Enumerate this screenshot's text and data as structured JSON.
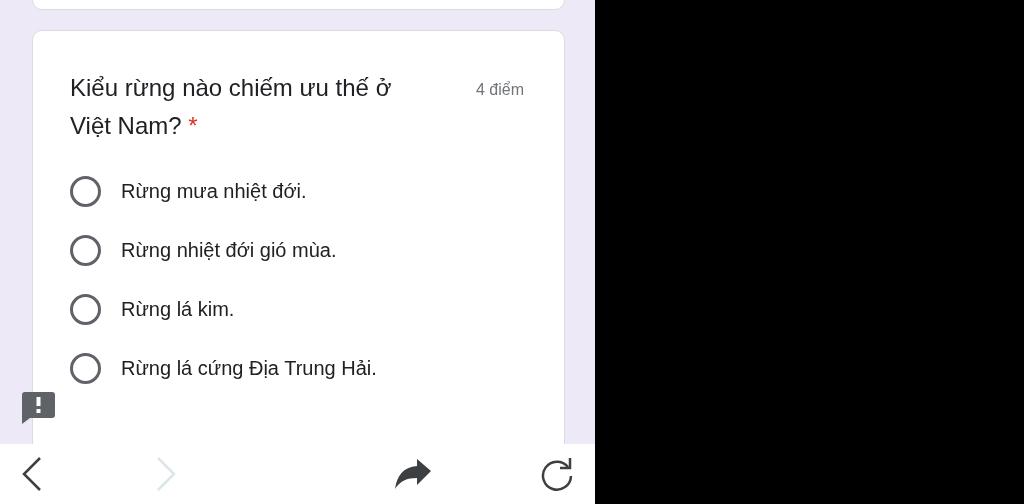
{
  "question": {
    "title": "Kiểu rừng nào chiếm ưu thế ở Việt Nam?",
    "required_mark": "*",
    "points": "4 điểm",
    "options": [
      {
        "label": "Rừng mưa nhiệt đới.",
        "selected": false
      },
      {
        "label": "Rừng nhiệt đới gió mùa.",
        "selected": false
      },
      {
        "label": "Rừng lá kim.",
        "selected": false
      },
      {
        "label": "Rừng lá cứng Địa Trung Hải.",
        "selected": false
      }
    ]
  },
  "browser_bar": {
    "back_disabled": false,
    "forward_disabled": true
  }
}
